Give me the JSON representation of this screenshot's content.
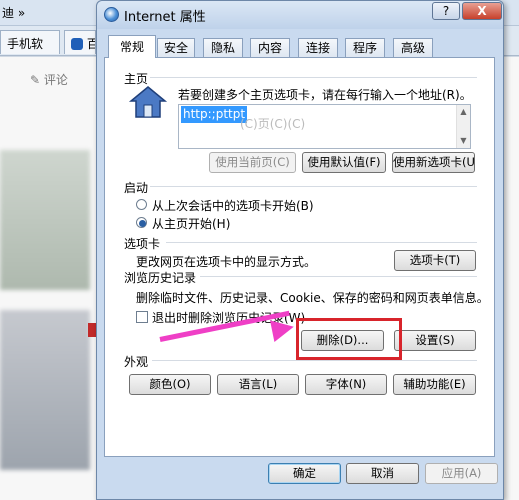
{
  "background": {
    "top_fragment": "迪 »",
    "tab1": "手机软",
    "tab2_icon": "paw-icon",
    "tab2_text": "百",
    "comment_label": "评论"
  },
  "dialog": {
    "title": "Internet 属性",
    "help_label": "?",
    "close_label": "X",
    "tabs": [
      "常规",
      "安全",
      "隐私",
      "内容",
      "连接",
      "程序",
      "高级"
    ],
    "active_tab": 0,
    "homepage": {
      "heading": "主页",
      "description": "若要创建多个主页选项卡，请在每行输入一个地址(R)。",
      "url_value": "http:;pttpt",
      "url_ghost": "(C)页(C)(C)",
      "buttons": [
        "使用当前页(C)",
        "使用默认值(F)",
        "使用新选项卡(U)"
      ]
    },
    "startup": {
      "heading": "启动",
      "options": [
        "从上次会话中的选项卡开始(B)",
        "从主页开始(H)"
      ],
      "selected": 1
    },
    "tabs_section": {
      "heading": "选项卡",
      "description": "更改网页在选项卡中的显示方式。",
      "button": "选项卡(T)"
    },
    "history": {
      "heading": "浏览历史记录",
      "description": "删除临时文件、历史记录、Cookie、保存的密码和网页表单信息。",
      "checkbox_label": "退出时删除浏览历史记录(W)",
      "checked": false,
      "delete_button": "删除(D)...",
      "settings_button": "设置(S)"
    },
    "appearance": {
      "heading": "外观",
      "buttons": [
        "颜色(O)",
        "语言(L)",
        "字体(N)",
        "辅助功能(E)"
      ]
    },
    "footer": {
      "ok": "确定",
      "cancel": "取消",
      "apply": "应用(A)"
    }
  },
  "annotation": {
    "arrow_color": "#ef3fc6",
    "box_color": "#d8242b"
  }
}
